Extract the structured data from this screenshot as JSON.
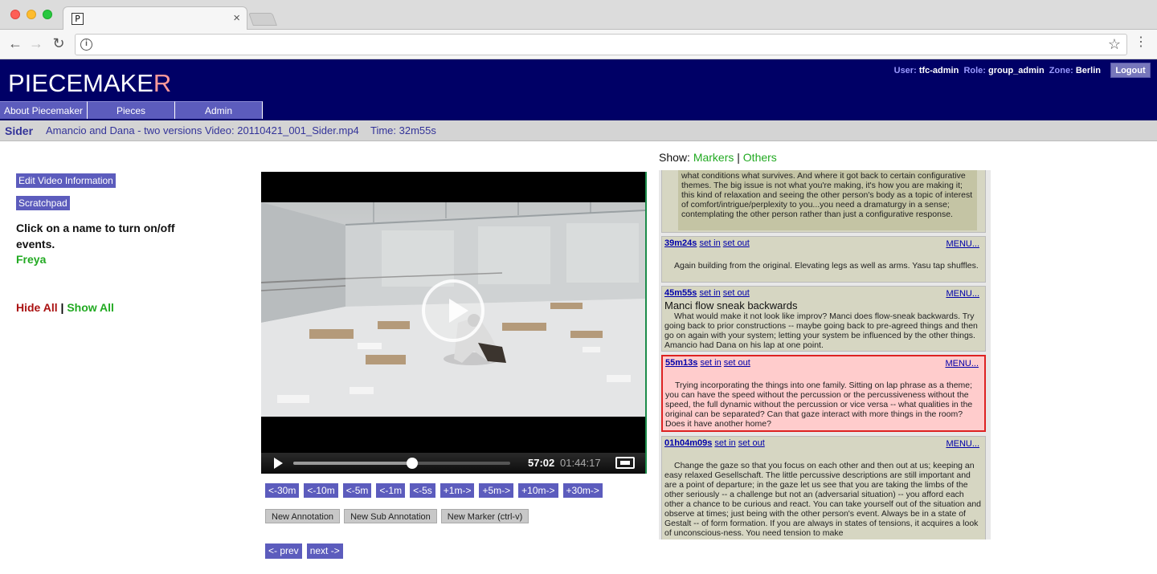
{
  "browser": {
    "tab_favicon": "P",
    "tab_close": "×"
  },
  "header": {
    "logo_main": "PIECEMAKE",
    "logo_accent": "R",
    "user_label": "User:",
    "user_value": "tfc-admin",
    "role_label": "Role:",
    "role_value": "group_admin",
    "zone_label": "Zone:",
    "zone_value": "Berlin",
    "logout": "Logout",
    "nav": [
      "About Piecemaker",
      "Pieces",
      "Admin"
    ]
  },
  "subheader": {
    "piece": "Sider",
    "video": "Amancio and Dana - two versions Video: 20110421_001_Sider.mp4",
    "time": "Time: 32m55s"
  },
  "sidebar": {
    "edit_video": "Edit Video Information",
    "scratchpad": "Scratchpad",
    "instructions": "Click on a name to turn on/off events.",
    "performer": "Freya",
    "hide_all": "Hide All",
    "separator": "|",
    "show_all": "Show All"
  },
  "player": {
    "current_time": "57:02",
    "duration": "01:44:17",
    "progress": 0.547
  },
  "skip_buttons": [
    "<-30m",
    "<-10m",
    "<-5m",
    "<-1m",
    "<-5s",
    "+1m->",
    "+5m->",
    "+10m->",
    "+30m->"
  ],
  "annotation_buttons": [
    "New Annotation",
    "New Sub Annotation",
    "New Marker (ctrl-v)"
  ],
  "paging": {
    "prev": "<- prev",
    "next": "next ->"
  },
  "show_filter": {
    "label": "Show:",
    "markers": "Markers",
    "sep": "|",
    "others": "Others"
  },
  "events": {
    "top_text": "what conditions what survives. And where it got back to certain configurative themes. The big issue is not what you're making, it's how you are making it; this kind of relaxation and seeing the other person's body as a topic of interest of comfort/intrigue/perplexity to you...you need a dramaturgy in a sense; contemplating the other person rather than just a configurative response.",
    "set_in": "set in",
    "set_out": "set out",
    "menu": "MENU...",
    "items": [
      {
        "time": "39m24s",
        "title": "",
        "text": "Again building from the original. Elevating legs as well as arms. Yasu tap shuffles."
      },
      {
        "time": "45m55s",
        "title": "Manci flow sneak backwards",
        "text": "What would make it not look like improv? Manci does flow-sneak backwards. Try going back to prior constructions -- maybe going back to pre-agreed things and then go on again with your system; letting your system be influenced by the other things. Amancio had Dana on his lap at one point."
      },
      {
        "time": "55m13s",
        "title": "",
        "text": "Trying incorporating the things into one family. Sitting on lap phrase as a theme; you can have the speed without the percussion or the percussiveness without the speed, the full dynamic without the percussion or vice versa -- what qualities in the original can be separated? Can that gaze interact with more things in the room? Does it have another home?"
      },
      {
        "time": "01h04m09s",
        "title": "",
        "text": "Change the gaze so that you focus on each other and then out at us; keeping an easy relaxed Gesellschaft. The little percussive descriptions are still important and are a point of departure; in the gaze let us see that you are taking the limbs of the other seriously -- a challenge but not an (adversarial situation) -- you afford each other a chance to be curious and react. You can take yourself out of the situation and observe at times; just being with the other person's event. Always be in a state of Gestalt -- of form formation. If you are always in states of tensions, it acquires a look of unconscious-ness. You need tension to make"
      }
    ]
  },
  "colors": {
    "header_bg": "#000066",
    "nav_button": "#5c5cbd",
    "active_event_bg": "#ffcccc",
    "active_event_border": "#dd2222",
    "event_bg": "#d6d6c2"
  },
  "icons": [
    "back-arrow-icon",
    "forward-arrow-icon",
    "reload-icon",
    "info-icon",
    "bookmark-star-icon",
    "kebab-menu-icon",
    "play-icon",
    "fullscreen-icon"
  ]
}
